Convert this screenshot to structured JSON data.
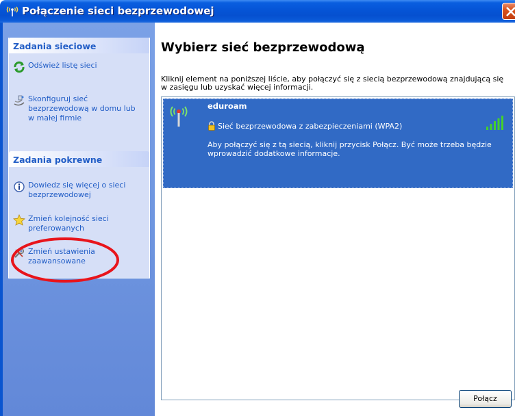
{
  "window": {
    "title": "Połączenie sieci bezprzewodowej"
  },
  "sidebar": {
    "network_tasks": {
      "title": "Zadania sieciowe",
      "items": [
        {
          "label": "Odśwież listę sieci",
          "icon": "refresh-icon"
        },
        {
          "label": "Skonfiguruj sieć bezprzewodową w domu lub w małej firmie",
          "icon": "wizard-icon"
        }
      ]
    },
    "related_tasks": {
      "title": "Zadania pokrewne",
      "items": [
        {
          "label": "Dowiedz się więcej o sieci bezprzewodowej",
          "icon": "info-icon"
        },
        {
          "label": "Zmień kolejność sieci preferowanych",
          "icon": "star-icon"
        },
        {
          "label": "Zmień ustawienia zaawansowane",
          "icon": "tools-icon"
        }
      ]
    }
  },
  "main": {
    "title": "Wybierz sieć bezprzewodową",
    "description": "Kliknij element na poniższej liście, aby połączyć się z siecią bezprzewodową znajdującą się w zasięgu lub uzyskać więcej informacji.",
    "networks": [
      {
        "name": "eduroam",
        "security": "Sieć bezprzewodowa z zabezpieczeniami (WPA2)",
        "info": "Aby połączyć się z tą siecią, kliknij przycisk Połącz. Być może trzeba będzie wprowadzić dodatkowe informacje.",
        "signal_bars": 5,
        "selected": true
      }
    ],
    "connect_button": "Połącz"
  },
  "annotation": {
    "color": "#e8141b"
  }
}
